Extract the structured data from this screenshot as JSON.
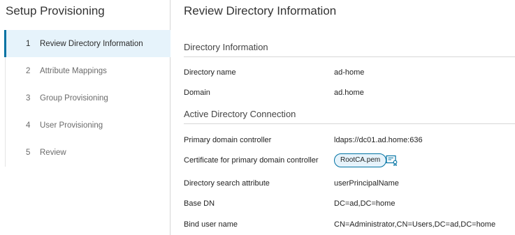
{
  "sidebar": {
    "title": "Setup Provisioning",
    "steps": [
      {
        "num": "1",
        "label": "Review Directory Information"
      },
      {
        "num": "2",
        "label": "Attribute Mappings"
      },
      {
        "num": "3",
        "label": "Group Provisioning"
      },
      {
        "num": "4",
        "label": "User Provisioning"
      },
      {
        "num": "5",
        "label": "Review"
      }
    ]
  },
  "main": {
    "title": "Review Directory Information",
    "directory_info": {
      "heading": "Directory Information",
      "name_label": "Directory name",
      "name_value": "ad-home",
      "domain_label": "Domain",
      "domain_value": "ad.home"
    },
    "ad_connection": {
      "heading": "Active Directory Connection",
      "pdc_label": "Primary domain controller",
      "pdc_value": "ldaps://dc01.ad.home:636",
      "cert_label": "Certificate for primary domain controller",
      "cert_value": "RootCA.pem",
      "search_attr_label": "Directory search attribute",
      "search_attr_value": "userPrincipalName",
      "base_dn_label": "Base DN",
      "base_dn_value": "DC=ad,DC=home",
      "bind_user_label": "Bind user name",
      "bind_user_value": "CN=Administrator,CN=Users,DC=ad,DC=home"
    }
  },
  "icons": {
    "certificate": "certificate-icon"
  },
  "colors": {
    "accent": "#0072a3",
    "active_bg": "#e6f3fb"
  }
}
